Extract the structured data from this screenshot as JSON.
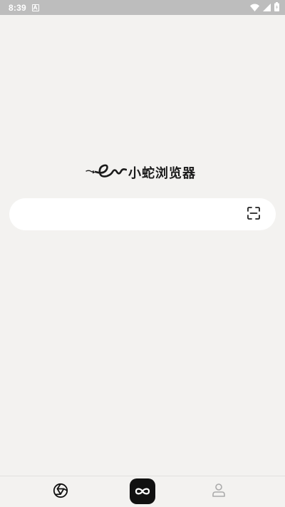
{
  "status_bar": {
    "time": "8:39",
    "notification_icon": "font-a-icon",
    "icons": [
      "wifi-icon",
      "cell-signal-icon",
      "battery-icon"
    ]
  },
  "logo": {
    "text": "小蛇浏览器",
    "emblem": "snake-logo-icon"
  },
  "search": {
    "value": "",
    "placeholder": "",
    "scan_icon": "scan-icon"
  },
  "bottom_nav": {
    "items": [
      {
        "id": "browser",
        "icon": "browser-ring-icon"
      },
      {
        "id": "center",
        "icon": "infinity-icon"
      },
      {
        "id": "profile",
        "icon": "person-icon"
      }
    ]
  },
  "colors": {
    "background": "#f3f2f0",
    "status_bar": "#bdbdbd",
    "search_bg": "#ffffff",
    "center_button": "#111111",
    "text_dark": "#1b1b1b",
    "icon_inactive": "#aaaaaa"
  }
}
